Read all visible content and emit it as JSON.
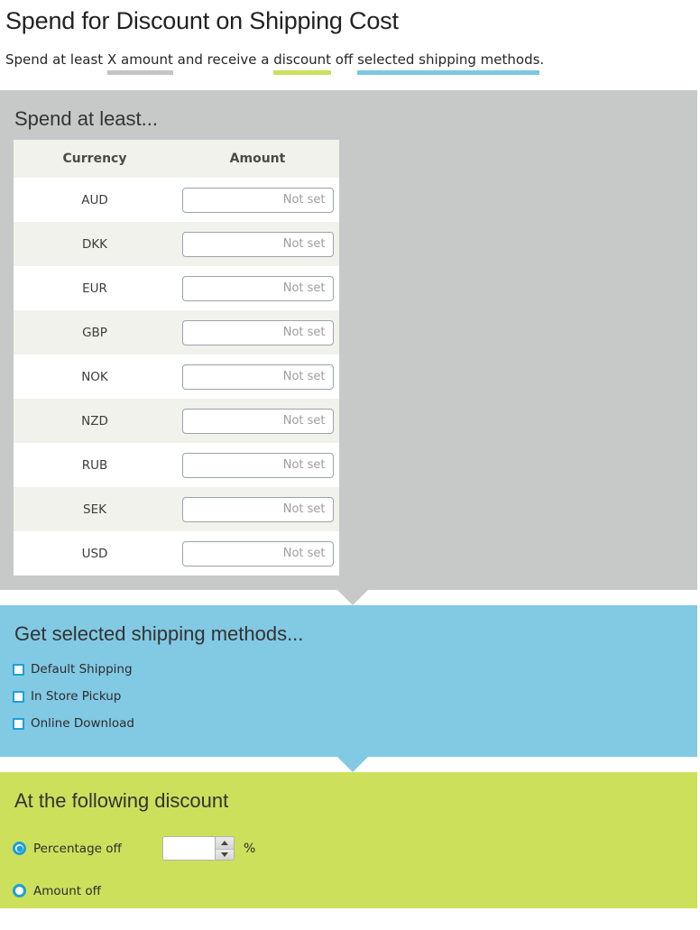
{
  "header": {
    "title": "Spend for Discount on Shipping Cost",
    "subtitle_parts": {
      "lead": "Spend at least ",
      "token_amount": "X amount",
      "mid1": " and receive a ",
      "token_discount": "discount",
      "mid2": " off ",
      "token_methods": "selected shipping methods",
      "tail": "."
    }
  },
  "colors": {
    "underline_gray": "#c4c4c4",
    "underline_green": "#cde05c",
    "underline_blue": "#7cc8e3",
    "panel_gray": "#c7c9c8",
    "panel_blue": "#82c9e3",
    "panel_green": "#cde05c",
    "control_blue": "#1e9fd8",
    "table_header_bg": "#f2f2ec",
    "row_stripe_bg": "#f2f2ec"
  },
  "spend_panel": {
    "heading": "Spend at least...",
    "table": {
      "columns": [
        "Currency",
        "Amount"
      ],
      "placeholder": "Not set",
      "rows": [
        {
          "currency": "AUD",
          "amount": ""
        },
        {
          "currency": "DKK",
          "amount": ""
        },
        {
          "currency": "EUR",
          "amount": ""
        },
        {
          "currency": "GBP",
          "amount": ""
        },
        {
          "currency": "NOK",
          "amount": ""
        },
        {
          "currency": "NZD",
          "amount": ""
        },
        {
          "currency": "RUB",
          "amount": ""
        },
        {
          "currency": "SEK",
          "amount": ""
        },
        {
          "currency": "USD",
          "amount": ""
        }
      ]
    }
  },
  "shipping_panel": {
    "heading": "Get selected shipping methods...",
    "methods": [
      {
        "label": "Default Shipping",
        "checked": false
      },
      {
        "label": "In Store Pickup",
        "checked": false
      },
      {
        "label": "Online Download",
        "checked": false
      }
    ]
  },
  "discount_panel": {
    "heading": "At the following discount",
    "options": [
      {
        "label": "Percentage off",
        "selected": true
      },
      {
        "label": "Amount off",
        "selected": false
      }
    ],
    "percentage_value": "",
    "percent_symbol": "%"
  }
}
